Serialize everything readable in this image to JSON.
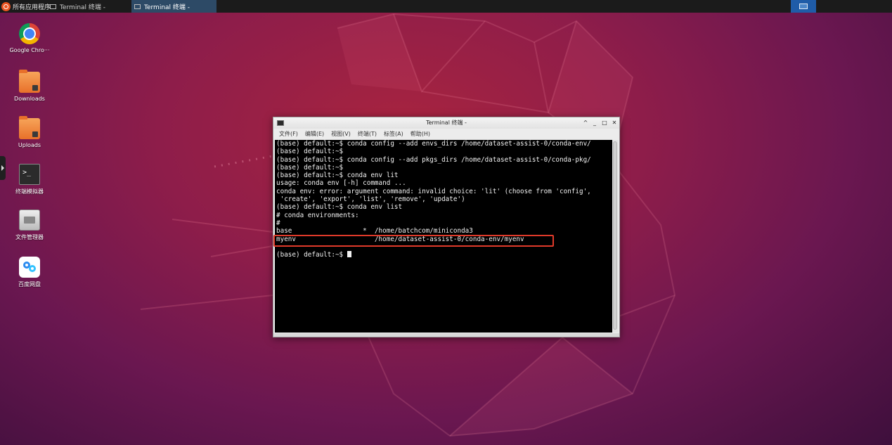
{
  "taskbar": {
    "app_menu_label": "所有应用程序",
    "tasks": [
      {
        "label": "Terminal 终端 -",
        "active": false
      },
      {
        "label": "Terminal 终端 -",
        "active": true
      }
    ]
  },
  "desktop": {
    "icons": [
      {
        "label": "Google Chro···",
        "icon": "chrome-icon"
      },
      {
        "label": "Downloads",
        "icon": "folder-icon"
      },
      {
        "label": "Uploads",
        "icon": "folder-icon"
      },
      {
        "label": "终端模拟器",
        "icon": "terminal-icon"
      },
      {
        "label": "文件管理器",
        "icon": "file-manager-icon"
      },
      {
        "label": "百度网盘",
        "icon": "baidu-netdisk-icon"
      }
    ]
  },
  "terminal": {
    "title": "Terminal 终端 -",
    "controls": {
      "up": "^",
      "minimize": "_",
      "maximize": "□",
      "close": "✕"
    },
    "menu": [
      "文件(F)",
      "编辑(E)",
      "视图(V)",
      "终端(T)",
      "标签(A)",
      "帮助(H)"
    ],
    "lines": [
      "(base) default:~$ conda config --add envs_dirs /home/dataset-assist-0/conda-env/",
      "(base) default:~$",
      "(base) default:~$ conda config --add pkgs_dirs /home/dataset-assist-0/conda-pkg/",
      "(base) default:~$",
      "(base) default:~$ conda env lit",
      "usage: conda env [-h] command ...",
      "conda env: error: argument command: invalid choice: 'lit' (choose from 'config',",
      " 'create', 'export', 'list', 'remove', 'update')",
      "(base) default:~$ conda env list",
      "# conda environments:",
      "#",
      "base                  *  /home/batchcom/miniconda3",
      "myenv                    /home/dataset-assist-0/conda-env/myenv",
      "",
      "(base) default:~$ "
    ]
  },
  "colors": {
    "highlight_box": "#e03a2a",
    "terminal_bg": "#000000",
    "terminal_fg": "#f2f2f2"
  }
}
